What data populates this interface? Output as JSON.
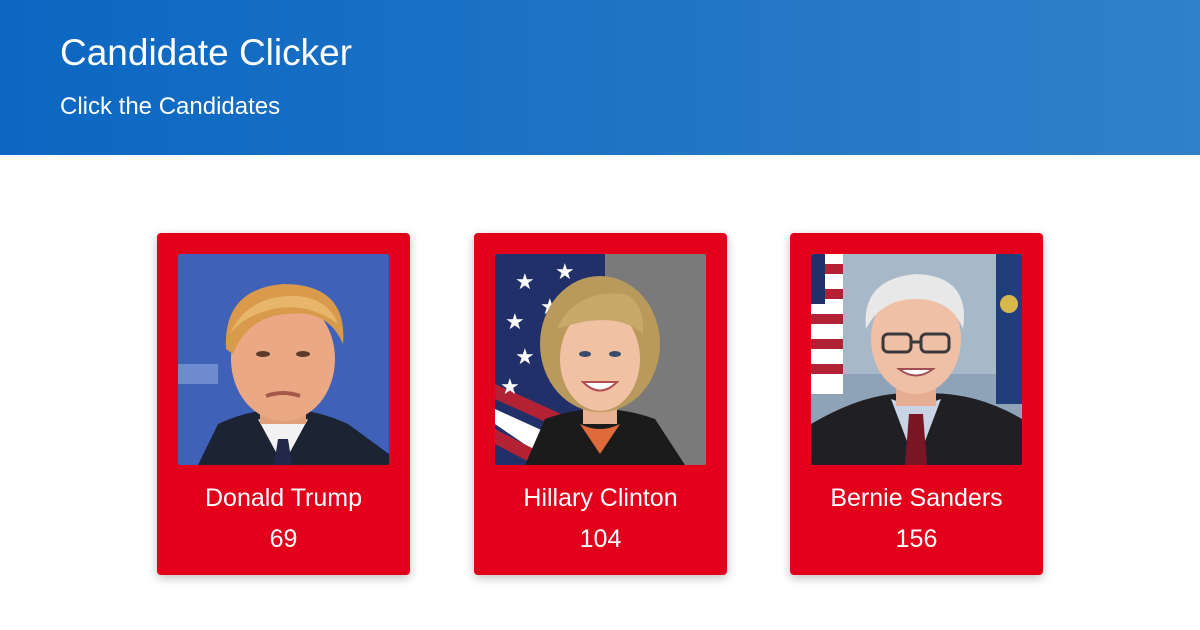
{
  "header": {
    "title": "Candidate Clicker",
    "subtitle": "Click the Candidates"
  },
  "candidates": [
    {
      "name": "Donald Trump",
      "clicks": "69",
      "icon": "candidate-photo-trump"
    },
    {
      "name": "Hillary Clinton",
      "clicks": "104",
      "icon": "candidate-photo-clinton"
    },
    {
      "name": "Bernie Sanders",
      "clicks": "156",
      "icon": "candidate-photo-sanders"
    }
  ],
  "colors": {
    "header_start": "#0b67c2",
    "header_end": "#2f81c9",
    "card_background": "#e3001b",
    "text": "#ffffff"
  }
}
